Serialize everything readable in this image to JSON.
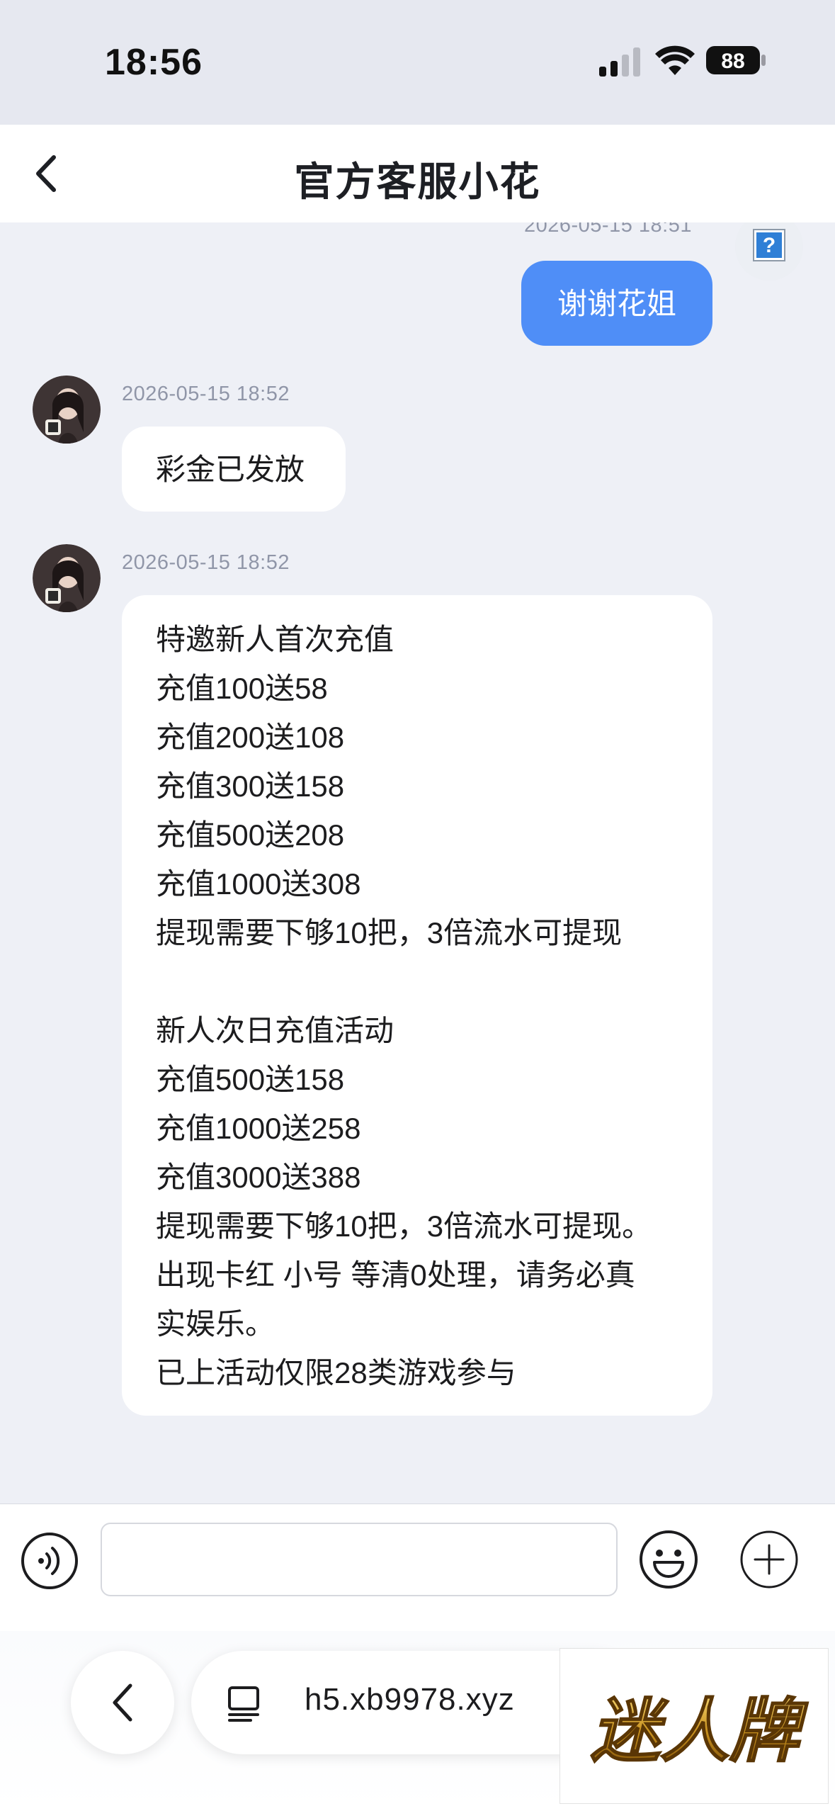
{
  "status_bar": {
    "time": "18:56",
    "battery": "88"
  },
  "header": {
    "title": "官方客服小花"
  },
  "messages": [
    {
      "direction": "out",
      "timestamp": "2026-05-15 18:51",
      "lines": [
        "谢谢花姐"
      ]
    },
    {
      "direction": "in",
      "timestamp": "2026-05-15 18:52",
      "lines": [
        "彩金已发放"
      ]
    },
    {
      "direction": "in",
      "timestamp": "2026-05-15 18:52",
      "lines": [
        "特邀新人首次充值",
        "充值100送58",
        "充值200送108",
        "充值300送158",
        "充值500送208",
        "充值1000送308",
        "提现需要下够10把，3倍流水可提现",
        "",
        "新人次日充值活动",
        "充值500送158",
        "充值1000送258",
        "充值3000送388",
        "提现需要下够10把，3倍流水可提现。",
        "出现卡红 小号 等清0处理，请务必真",
        "实娱乐。",
        "已上活动仅限28类游戏参与"
      ]
    }
  ],
  "input": {
    "value": "",
    "placeholder": ""
  },
  "browser": {
    "url": "h5.xb9978.xyz"
  },
  "watermark": {
    "text": "迷人牌"
  },
  "colors": {
    "accent": "#4f8ef7",
    "background": "#eef0f6",
    "timestamp": "#9096a8"
  }
}
